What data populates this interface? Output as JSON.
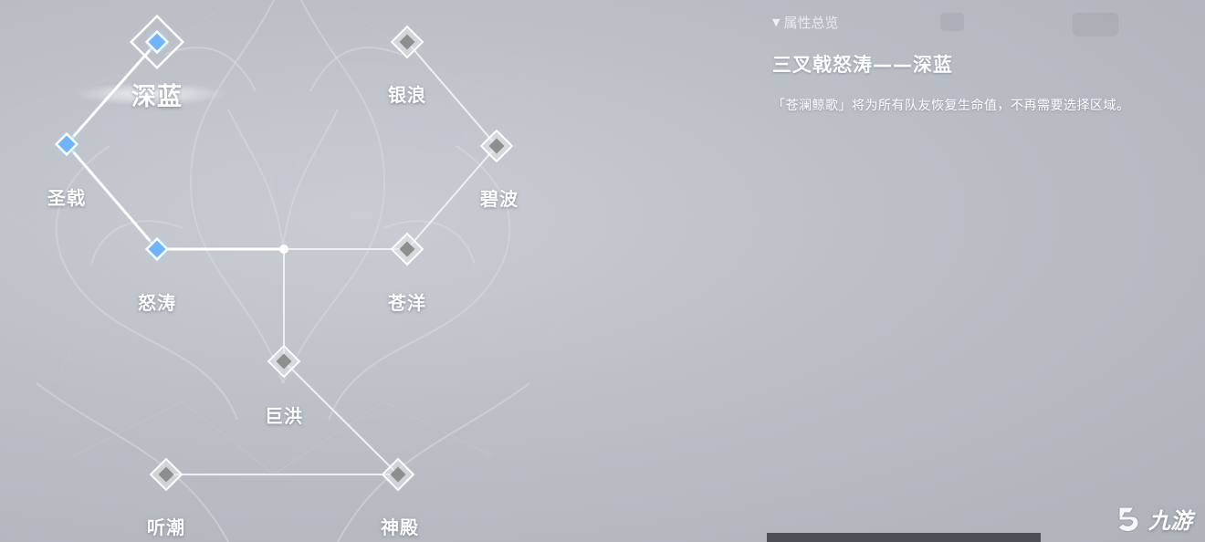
{
  "constellation": {
    "nodes": [
      {
        "id": "shenlan",
        "label": "深蓝",
        "active": true,
        "selected": true
      },
      {
        "id": "shengji",
        "label": "圣戟",
        "active": true,
        "selected": false
      },
      {
        "id": "nutao",
        "label": "怒涛",
        "active": true,
        "selected": false
      },
      {
        "id": "yinlang",
        "label": "银浪",
        "active": false,
        "selected": false
      },
      {
        "id": "bibo",
        "label": "碧波",
        "active": false,
        "selected": false
      },
      {
        "id": "cangyang",
        "label": "苍洋",
        "active": false,
        "selected": false
      },
      {
        "id": "juhong",
        "label": "巨洪",
        "active": false,
        "selected": false
      },
      {
        "id": "tingchao",
        "label": "听潮",
        "active": false,
        "selected": false
      },
      {
        "id": "shendian",
        "label": "神殿",
        "active": false,
        "selected": false
      }
    ]
  },
  "panel": {
    "header": "属性总览",
    "title": "三叉戟怒涛——深蓝",
    "description": "「苍澜鲸歌」将为所有队友恢复生命值，不再需要选择区域。"
  },
  "watermark": {
    "text": "九游"
  },
  "colors": {
    "active_node": "#6fb4ff",
    "inactive_node": "#8e8e8e",
    "active_line": "#ffffff",
    "inactive_line": "#eef0f3"
  }
}
